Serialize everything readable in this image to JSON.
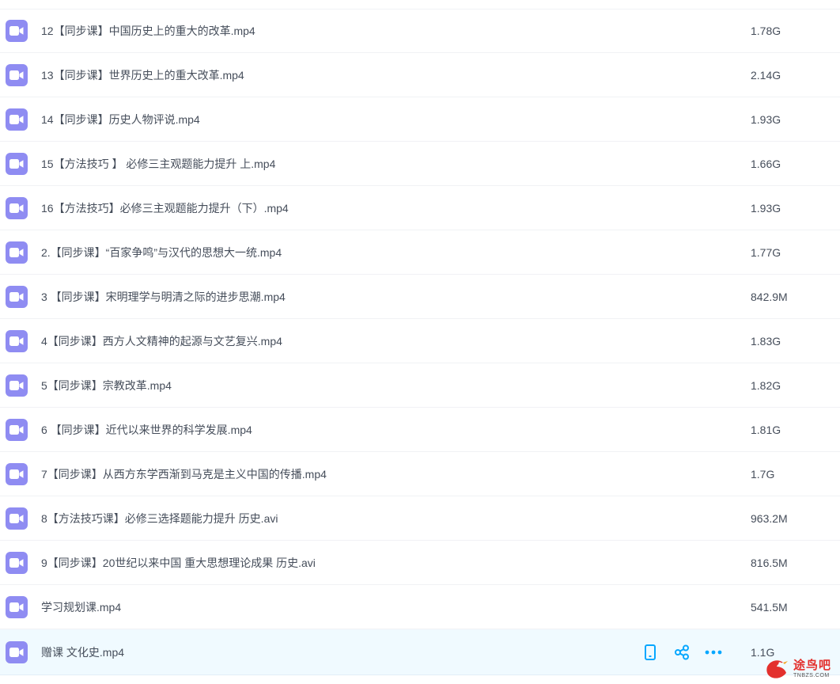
{
  "files": [
    {
      "name": "12【同步课】中国历史上的重大的改革.mp4",
      "size": "1.78G"
    },
    {
      "name": "13【同步课】世界历史上的重大改革.mp4",
      "size": "2.14G"
    },
    {
      "name": "14【同步课】历史人物评说.mp4",
      "size": "1.93G"
    },
    {
      "name": "15【方法技巧 】 必修三主观题能力提升 上.mp4",
      "size": "1.66G"
    },
    {
      "name": "16【方法技巧】必修三主观题能力提升（下）.mp4",
      "size": "1.93G"
    },
    {
      "name": "2.【同步课】“百家争鸣”与汉代的思想大一统.mp4",
      "size": "1.77G"
    },
    {
      "name": "3 【同步课】宋明理学与明清之际的进步思潮.mp4",
      "size": "842.9M"
    },
    {
      "name": "4【同步课】西方人文精神的起源与文艺复兴.mp4",
      "size": "1.83G"
    },
    {
      "name": "5【同步课】宗教改革.mp4",
      "size": "1.82G"
    },
    {
      "name": "6 【同步课】近代以来世界的科学发展.mp4",
      "size": "1.81G"
    },
    {
      "name": "7【同步课】从西方东学西渐到马克是主义中国的传播.mp4",
      "size": "1.7G"
    },
    {
      "name": "8【方法技巧课】必修三选择题能力提升 历史.avi",
      "size": "963.2M"
    },
    {
      "name": "9【同步课】20世纪以来中国 重大思想理论成果 历史.avi",
      "size": "816.5M"
    },
    {
      "name": "学习规划课.mp4",
      "size": "541.5M"
    },
    {
      "name": "赠课 文化史.mp4",
      "size": "1.1G"
    }
  ],
  "hovered_index": 14,
  "row_actions": [
    "phone-icon",
    "share-icon",
    "more-icon"
  ],
  "watermark": {
    "cn": "途鸟吧",
    "en": "TNBZS.COM"
  },
  "colors": {
    "video_icon": "#8f8cf2",
    "action": "#06a7ff",
    "hover_bg": "#f0faff"
  }
}
